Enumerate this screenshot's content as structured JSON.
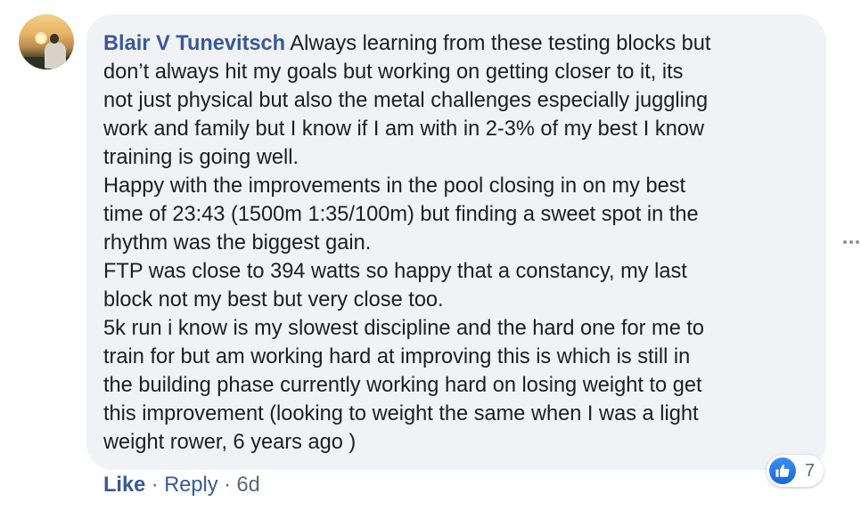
{
  "comment": {
    "author": "Blair V Tunevitsch",
    "lines": [
      "Always learning from these testing blocks but",
      "don’t always hit my goals but working on getting closer to it, its",
      "not just physical but also the metal challenges especially juggling",
      "work and family but I know if I am with in 2-3% of my best I know",
      "training is going well.",
      "Happy with the improvements in the pool closing in on my best",
      "time of 23:43 (1500m 1:35/100m) but finding a sweet spot in the",
      "rhythm was the biggest gain.",
      "FTP was close to 394 watts so happy that a constancy, my last",
      "block not my best but very close too.",
      "5k run i know is my slowest discipline and the hard one for me to",
      "train for but am working hard at improving this is which is still in",
      "the building phase currently working hard on losing weight to get",
      "this improvement (looking to weight the same when I was a light",
      "weight rower, 6 years ago )"
    ]
  },
  "reactions": {
    "icon": "thumbs-up-icon",
    "count": "7"
  },
  "actions": {
    "like": "Like",
    "separator": "·",
    "reply": "Reply",
    "time": "6d"
  },
  "colors": {
    "link": "#385898",
    "bubble": "#f0f2f5",
    "text": "#1c1e21",
    "meta": "#606770",
    "reaction_blue": "#1877f2"
  }
}
